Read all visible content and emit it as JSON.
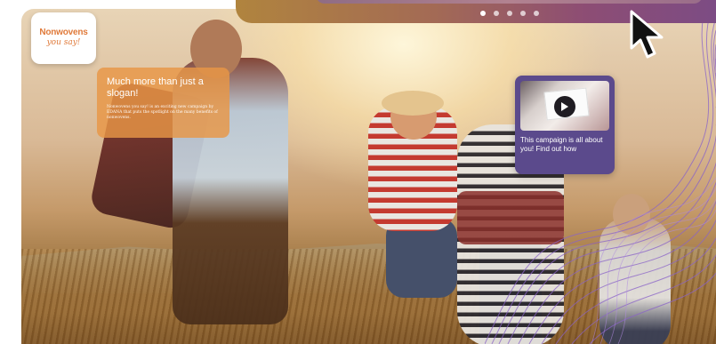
{
  "logo": {
    "main": "Nonwovens",
    "sub": "you say!"
  },
  "callout": {
    "title": "Much more than just a slogan!",
    "body": "Nonwovens you say! is an exciting new campaign by EDANA that puts the spotlight on the many benefits of nonwovens."
  },
  "video_card": {
    "text": "This campaign is all about you! Find out how",
    "icon": "play-icon"
  },
  "carousel": {
    "slides": 5,
    "active_index": 0
  },
  "colors": {
    "accent_orange": "#e07a3a",
    "callout_bg": "#e89646",
    "card_purple": "#5b4a8c",
    "wave_purple": "#8a63c8"
  },
  "cursor": {
    "icon": "arrow-cursor-icon"
  }
}
